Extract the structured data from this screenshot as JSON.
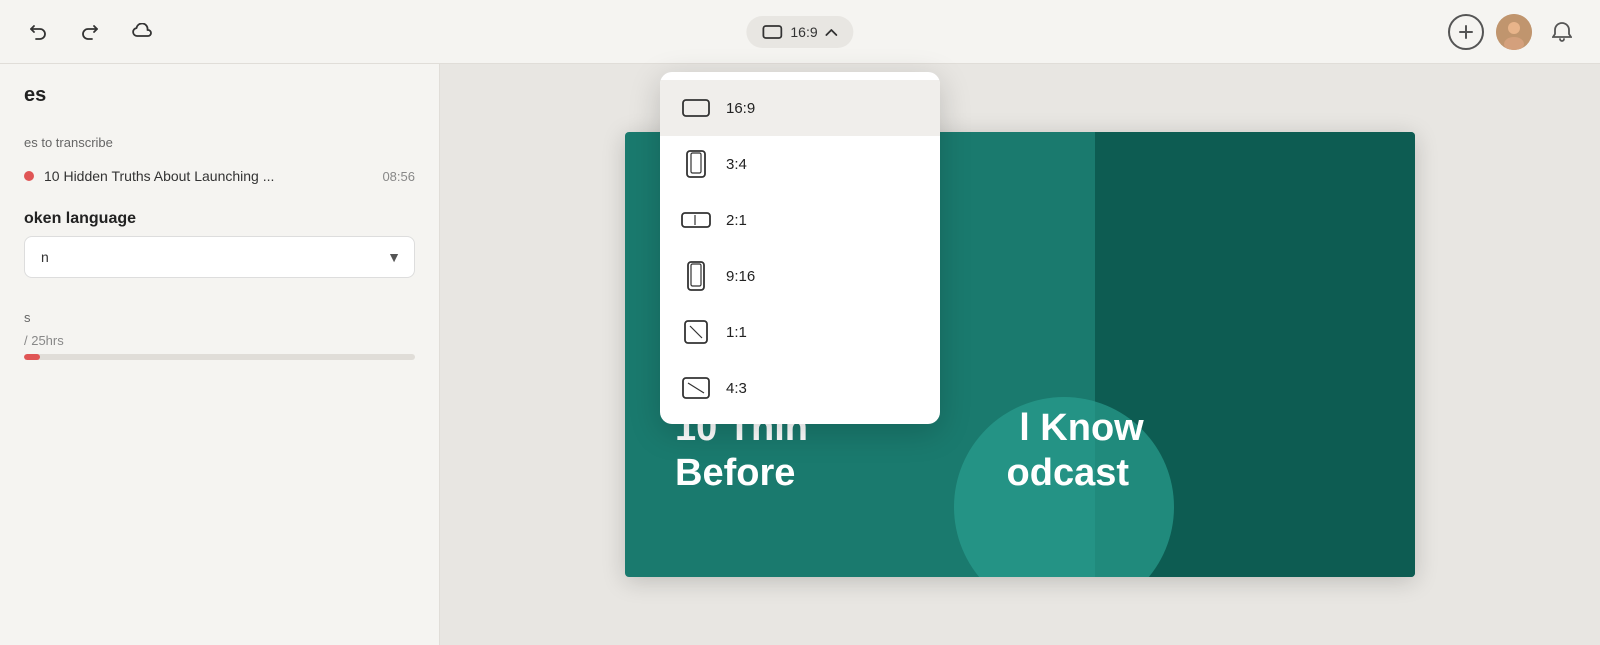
{
  "toolbar": {
    "undo_label": "↩",
    "redo_label": "↪",
    "cloud_label": "☁",
    "aspect_ratio": "16:9",
    "chevron_up": "▲",
    "add_label": "+",
    "bell_label": "🔔"
  },
  "sidebar": {
    "section_title": "es",
    "transcribe_label": "es to transcribe",
    "files": [
      {
        "name": "10 Hidden Truths About Launching ...",
        "duration": "08:56"
      }
    ],
    "spoken_language_label": "oken language",
    "language_value": "n",
    "hours_label": "s",
    "hours_progress_label": "/ 25hrs",
    "hours_fill_percent": 4
  },
  "aspect_options": [
    {
      "label": "16:9",
      "icon": "landscape",
      "active": true
    },
    {
      "label": "3:4",
      "icon": "portrait",
      "active": false
    },
    {
      "label": "2:1",
      "icon": "landscape-wide",
      "active": false
    },
    {
      "label": "9:16",
      "icon": "portrait-tall",
      "active": false
    },
    {
      "label": "1:1",
      "icon": "square",
      "active": false
    },
    {
      "label": "4:3",
      "icon": "landscape-standard",
      "active": false
    }
  ],
  "slide": {
    "text_line1": "10 Thin",
    "text_line2": "Before",
    "text_right1": "l Know",
    "text_right2": "odcast"
  },
  "colors": {
    "accent": "#1a7a6e",
    "accent_dark": "#0d5c52",
    "danger": "#e05555",
    "bg": "#f5f4f1"
  }
}
